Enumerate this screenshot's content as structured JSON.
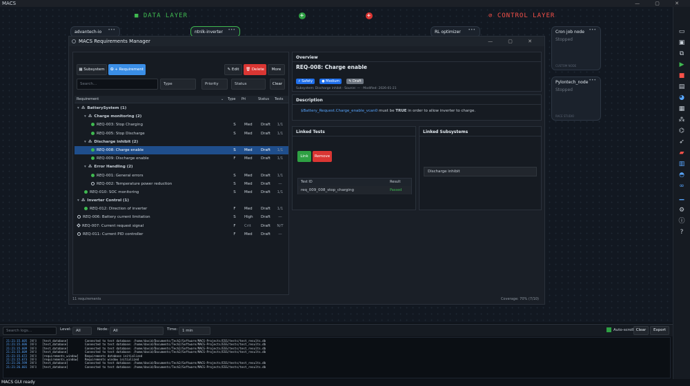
{
  "app_title": "MACS",
  "layers": {
    "data": "■ DATA LAYER",
    "control": "⊘ CONTROL LAYER"
  },
  "nodes": [
    {
      "title": "advantech-io",
      "status": "",
      "footer": ""
    },
    {
      "title": "ntnlk-inverter",
      "status": "",
      "footer": ""
    },
    {
      "title": "RL optimizer",
      "status": "",
      "footer": ""
    },
    {
      "title": "Cron job node",
      "status": "Stopped",
      "footer": "CUSTOM NODE"
    },
    {
      "title": "Pylontech_node",
      "status": "Stopped",
      "footer": "RACE STUDIO"
    }
  ],
  "dialog": {
    "title": "MACS Requirements Manager",
    "toolbar": {
      "subsystem": "▦ Subsystem",
      "add_requirement": "✪ + Requirement",
      "edit": "✎ Edit",
      "delete": "🗑 Delete",
      "more": "More"
    },
    "filters": {
      "search_placeholder": "Search...",
      "type": "Type",
      "priority": "Priority",
      "status": "Status",
      "clear": "Clear"
    },
    "columns": {
      "requirement": "Requirement",
      "type": "Type",
      "pri": "Pri",
      "status": "Status",
      "tests": "Tests"
    },
    "rows": [
      {
        "label": "BatterySystem  (1)",
        "kind": "group",
        "indent": 0,
        "arrow": "▾",
        "type": "",
        "pri": "",
        "status": "",
        "tests": ""
      },
      {
        "label": "Charge monitoring  (2)",
        "kind": "group",
        "indent": 1,
        "arrow": "▾",
        "type": "",
        "pri": "",
        "status": "",
        "tests": ""
      },
      {
        "label": "REQ-003: Stop Charging",
        "kind": "g",
        "indent": 2,
        "type": "S",
        "pri": "Med",
        "status": "Draft",
        "tests": "1/1"
      },
      {
        "label": "REQ-005: Stop Discharge",
        "kind": "g",
        "indent": 2,
        "type": "S",
        "pri": "Med",
        "status": "Draft",
        "tests": "1/1"
      },
      {
        "label": "Discharge inhibit  (2)",
        "kind": "group",
        "indent": 1,
        "arrow": "▾",
        "type": "",
        "pri": "",
        "status": "",
        "tests": ""
      },
      {
        "label": "REQ-008: Charge enable",
        "kind": "g",
        "indent": 2,
        "type": "S",
        "pri": "Med",
        "status": "Draft",
        "tests": "1/1",
        "selected": true
      },
      {
        "label": "REQ-009: Discharge enable",
        "kind": "g",
        "indent": 2,
        "type": "F",
        "pri": "Med",
        "status": "Draft",
        "tests": "1/1"
      },
      {
        "label": "Error Handling  (2)",
        "kind": "group",
        "indent": 1,
        "arrow": "▾",
        "type": "",
        "pri": "",
        "status": "",
        "tests": ""
      },
      {
        "label": "REQ-001: General errors",
        "kind": "g",
        "indent": 2,
        "type": "S",
        "pri": "Med",
        "status": "Draft",
        "tests": "1/1"
      },
      {
        "label": "REQ-002: Temperature power reduction",
        "kind": "o",
        "indent": 2,
        "type": "S",
        "pri": "Med",
        "status": "Draft",
        "tests": "—"
      },
      {
        "label": "REQ-010: SOC monitoring",
        "kind": "g",
        "indent": 1,
        "type": "S",
        "pri": "Med",
        "status": "Draft",
        "tests": "1/1"
      },
      {
        "label": "Inverter Control  (1)",
        "kind": "group",
        "indent": 0,
        "arrow": "▾",
        "type": "",
        "pri": "",
        "status": "",
        "tests": ""
      },
      {
        "label": "REQ-012: Direction of inverter",
        "kind": "g",
        "indent": 1,
        "type": "F",
        "pri": "Med",
        "status": "Draft",
        "tests": "1/1"
      },
      {
        "label": "REQ-006: Battery current limitation",
        "kind": "o",
        "indent": 0,
        "type": "S",
        "pri": "High",
        "status": "Draft",
        "tests": "—"
      },
      {
        "label": "REQ-007: Current request signal",
        "kind": "d",
        "indent": 0,
        "type": "F",
        "pri": "Crit",
        "status": "Draft",
        "tests": "N/T"
      },
      {
        "label": "REQ-011: Current PID controller",
        "kind": "o",
        "indent": 0,
        "type": "F",
        "pri": "Med",
        "status": "Draft",
        "tests": "—"
      }
    ],
    "count": "11 requirements",
    "coverage": "Coverage: 70% (7/10)",
    "overview": {
      "title": "Overview",
      "req_title": "REQ-008: Charge enable",
      "tags": [
        "⚡ Safety",
        "● Medium",
        "✎ Draft"
      ],
      "meta": "Subsystem: Discharge inhibit  ·  Source: —  ·  Modified: 2026-01-21"
    },
    "description": {
      "title": "Description",
      "signal": "$Battery_Request.Charge_enable_vcan0",
      "text1": " must be ",
      "bold": "TRUE",
      "text2": " in order to allow inverter to charge."
    },
    "linked_tests": {
      "title": "Linked Tests",
      "link": "Link",
      "remove": "Remove",
      "col_id": "Test ID",
      "col_result": "Result",
      "rows": [
        {
          "id": "req_009_008_stop_charging",
          "result": "Passed"
        }
      ]
    },
    "linked_subsystems": {
      "title": "Linked Subsystems",
      "items": [
        "Discharge inhibit"
      ]
    }
  },
  "logbar": {
    "search_placeholder": "Search logs...",
    "level_label": "Level:",
    "level": "All",
    "node_label": "Node:",
    "node": "All",
    "time_label": "Time:",
    "time": "1 min",
    "autoscroll": "Auto-scroll",
    "clear": "Clear",
    "export": "Export"
  },
  "logs": [
    [
      "21:21:15.605",
      "INFO",
      "[test_database]",
      "Connected to test database: /home/david/Documents/Tech2/Software/MACS-Projects/ESS/tests/test_results.db"
    ],
    [
      "21:21:15.606",
      "INFO",
      "[test_database]",
      "Connected to test database: /home/david/Documents/Tech2/Software/MACS-Projects/ESS/tests/test_results.db"
    ],
    [
      "21:21:15.609",
      "INFO",
      "[test_database]",
      "Connected to test database: /home/david/Documents/Tech2/Software/MACS-Projects/ESS/tests/test_results.db"
    ],
    [
      "21:21:15.609",
      "INFO",
      "[test_database]",
      "Connected to test database: /home/david/Documents/Tech2/Software/MACS-Projects/ESS/tests/test_results.db"
    ],
    [
      "21:21:15.672",
      "INFO",
      "[requirements_window]",
      "Requirements database initialized"
    ],
    [
      "21:21:15.673",
      "INFO",
      "[requirements_window]",
      "Requirements window initialized"
    ],
    [
      "21:21:26.599",
      "INFO",
      "[test_database]",
      "Connected to test database: /home/david/Documents/Tech2/Software/MACS-Projects/ESS/tests/test_results.db"
    ],
    [
      "21:21:26.601",
      "INFO",
      "[test_database]",
      "Connected to test database: /home/david/Documents/Tech2/Software/MACS-Projects/ESS/tests/test_results.db"
    ]
  ],
  "status": "MACS GUI ready",
  "rail_icons": [
    "folder-icon",
    "save-icon",
    "save-as-icon",
    "play-icon",
    "stop-icon",
    "document-icon",
    "palette-icon",
    "table-icon",
    "network-icon",
    "graph-icon",
    "rocket-icon",
    "battery-icon",
    "clipboard-icon",
    "car-icon",
    "link-icon",
    "chart-icon",
    "gear-icon",
    "info-icon",
    "help-icon"
  ]
}
